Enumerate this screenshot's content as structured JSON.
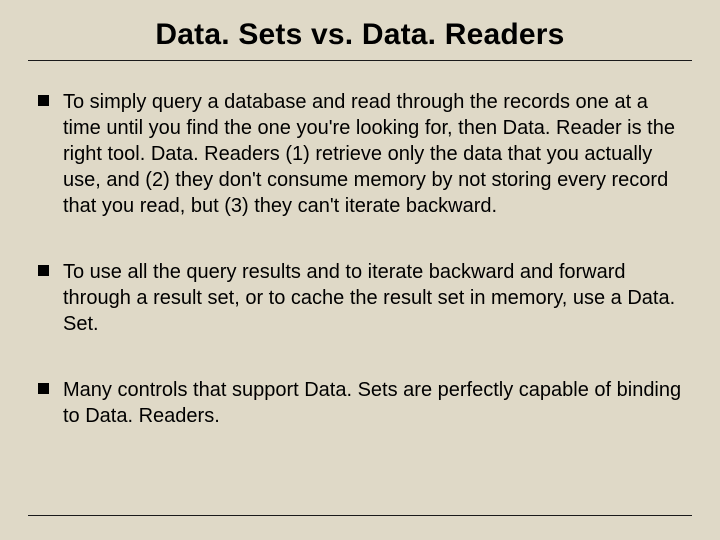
{
  "title": "Data. Sets vs. Data. Readers",
  "bullets": [
    {
      "text": "To simply query a database and read through the records one at a time until you find the one you're looking for, then Data. Reader is the right tool. Data. Readers (1) retrieve only the data that you actually use, and (2) they don't consume memory by not storing every record that you read, but (3) they can't iterate backward."
    },
    {
      "text": "To use all the query results and to iterate backward and forward through a result set, or to cache the result set in memory, use a Data. Set."
    },
    {
      "text": "Many controls that support Data. Sets are perfectly capable of binding to Data. Readers."
    }
  ]
}
